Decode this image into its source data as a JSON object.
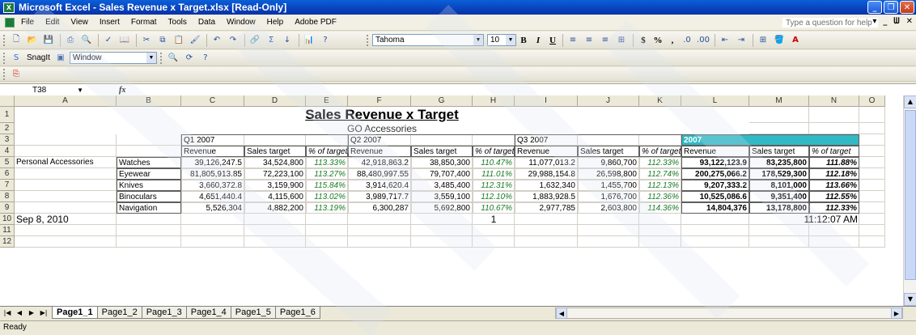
{
  "window": {
    "title": "Microsoft Excel - Sales Revenue x Target.xlsx  [Read-Only]"
  },
  "menu": [
    "File",
    "Edit",
    "View",
    "Insert",
    "Format",
    "Tools",
    "Data",
    "Window",
    "Help",
    "Adobe PDF"
  ],
  "help_placeholder": "Type a question for help",
  "toolbar": {
    "font_name": "Tahoma",
    "font_size": "10",
    "bold": "B",
    "italic": "I",
    "underline": "U",
    "currency": "$",
    "percent": "%",
    "comma": ","
  },
  "snagit": {
    "label": "SnagIt",
    "window_label": "Window"
  },
  "formula_bar": {
    "name_box": "T38",
    "fx": "fx"
  },
  "columns": [
    "A",
    "B",
    "C",
    "D",
    "E",
    "F",
    "G",
    "H",
    "I",
    "J",
    "K",
    "L",
    "M",
    "N",
    "O"
  ],
  "rows": [
    "1",
    "2",
    "3",
    "4",
    "5",
    "6",
    "7",
    "8",
    "9",
    "10",
    "11",
    "12"
  ],
  "sheet": {
    "title": "Sales Revenue x Target",
    "subtitle": "GO Accessories",
    "periods": [
      "Q1 2007",
      "Q2 2007",
      "Q3 2007",
      "2007"
    ],
    "headers": [
      "Revenue",
      "Sales target",
      "% of target"
    ],
    "category": "Personal Accessories",
    "products": [
      {
        "name": "Watches",
        "q1": [
          "39,126,247.5",
          "34,524,800",
          "113.33%"
        ],
        "q2": [
          "42,918,863.2",
          "38,850,300",
          "110.47%"
        ],
        "q3": [
          "11,077,013.2",
          "9,860,700",
          "112.33%"
        ],
        "y": [
          "93,122,123.9",
          "83,235,800",
          "111.88%"
        ]
      },
      {
        "name": "Eyewear",
        "q1": [
          "81,805,913.85",
          "72,223,100",
          "113.27%"
        ],
        "q2": [
          "88,480,997.55",
          "79,707,400",
          "111.01%"
        ],
        "q3": [
          "29,988,154.8",
          "26,598,800",
          "112.74%"
        ],
        "y": [
          "200,275,066.2",
          "178,529,300",
          "112.18%"
        ]
      },
      {
        "name": "Knives",
        "q1": [
          "3,660,372.8",
          "3,159,900",
          "115.84%"
        ],
        "q2": [
          "3,914,620.4",
          "3,485,400",
          "112.31%"
        ],
        "q3": [
          "1,632,340",
          "1,455,700",
          "112.13%"
        ],
        "y": [
          "9,207,333.2",
          "8,101,000",
          "113.66%"
        ]
      },
      {
        "name": "Binoculars",
        "q1": [
          "4,651,440.4",
          "4,115,600",
          "113.02%"
        ],
        "q2": [
          "3,989,717.7",
          "3,559,100",
          "112.10%"
        ],
        "q3": [
          "1,883,928.5",
          "1,676,700",
          "112.36%"
        ],
        "y": [
          "10,525,086.6",
          "9,351,400",
          "112.55%"
        ]
      },
      {
        "name": "Navigation",
        "q1": [
          "5,526,304",
          "4,882,200",
          "113.19%"
        ],
        "q2": [
          "6,300,287",
          "5,692,800",
          "110.67%"
        ],
        "q3": [
          "2,977,785",
          "2,603,800",
          "114.36%"
        ],
        "y": [
          "14,804,376",
          "13,178,800",
          "112.33%"
        ]
      }
    ],
    "footer_date": "Sep 8, 2010",
    "footer_page": "1",
    "footer_time": "11:12:07 AM"
  },
  "tabs": [
    "Page1_1",
    "Page1_2",
    "Page1_3",
    "Page1_4",
    "Page1_5",
    "Page1_6"
  ],
  "status": "Ready",
  "colors": {
    "accent_2007": "#31b9c4",
    "pct_green": "#177c24",
    "title_bar": "#0a5fd9"
  }
}
